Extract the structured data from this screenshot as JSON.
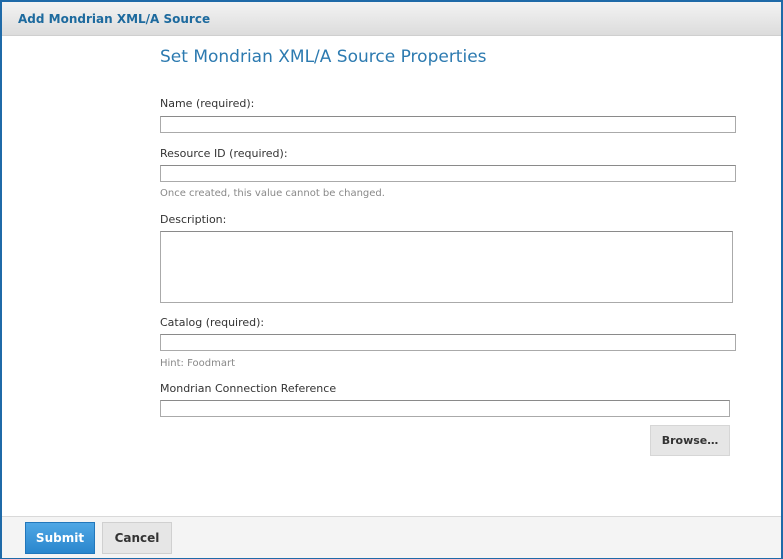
{
  "dialog": {
    "title": "Add Mondrian XML/A Source"
  },
  "form": {
    "heading": "Set Mondrian XML/A Source Properties",
    "name_label": "Name (required):",
    "name_value": "",
    "resource_id_label": "Resource ID  (required):",
    "resource_id_value": "",
    "resource_id_hint": "Once created, this value cannot be changed.",
    "description_label": "Description:",
    "description_value": "",
    "catalog_label": "Catalog (required):",
    "catalog_value": "",
    "catalog_hint": "Hint: Foodmart",
    "connection_ref_label": "Mondrian Connection Reference",
    "connection_ref_value": "",
    "browse_label": "Browse…"
  },
  "footer": {
    "submit_label": "Submit",
    "cancel_label": "Cancel"
  }
}
